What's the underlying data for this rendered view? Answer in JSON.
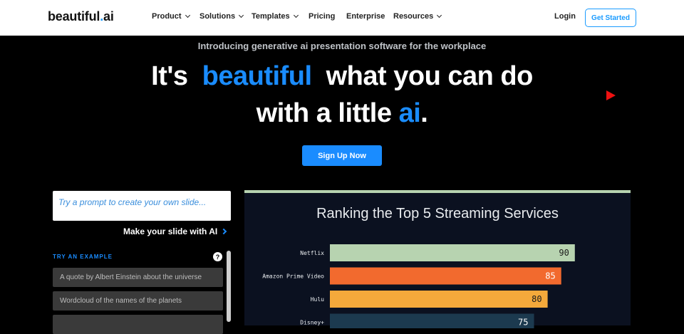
{
  "nav": {
    "logo_text": "beautiful",
    "logo_dot": ".",
    "logo_ai": "ai",
    "items": [
      {
        "label": "Product",
        "has_dropdown": true
      },
      {
        "label": "Solutions",
        "has_dropdown": true
      },
      {
        "label": "Templates",
        "has_dropdown": true
      },
      {
        "label": "Pricing",
        "has_dropdown": false
      },
      {
        "label": "Enterprise",
        "has_dropdown": false
      },
      {
        "label": "Resources",
        "has_dropdown": true
      }
    ],
    "login": "Login",
    "get_started": "Get Started"
  },
  "hero": {
    "intro": "Introducing generative ai presentation software for the workplace",
    "line1_a": "It's",
    "line1_b": "beautiful",
    "line1_c": "what you can do",
    "line2_a": "with a little",
    "line2_b": "ai",
    "line2_c": ".",
    "signup": "Sign Up Now"
  },
  "prompt": {
    "placeholder": "Try a prompt to create your own slide...",
    "make": "Make your slide with AI",
    "try_label": "TRY AN EXAMPLE",
    "help": "?",
    "examples": [
      "A quote by Albert Einstein about the universe",
      "Wordcloud of the names of the planets",
      ""
    ]
  },
  "colors": {
    "accent": "#1a8cff",
    "play": "#e11111",
    "slide_bg": "#0b1120"
  },
  "chart_data": {
    "type": "bar",
    "title": "Ranking the Top 5 Streaming Services",
    "categories": [
      "Netflix",
      "Amazon Prime Video",
      "Hulu",
      "Disney+"
    ],
    "values": [
      90,
      85,
      80,
      75
    ],
    "colors": [
      "#b7d3b0",
      "#f26a2e",
      "#f4a93b",
      "#1c3a4f"
    ],
    "value_label_colors": [
      "#1b1b1b",
      "#ffffff",
      "#1b1b1b",
      "#ffffff"
    ],
    "xlim": [
      0,
      100
    ]
  }
}
